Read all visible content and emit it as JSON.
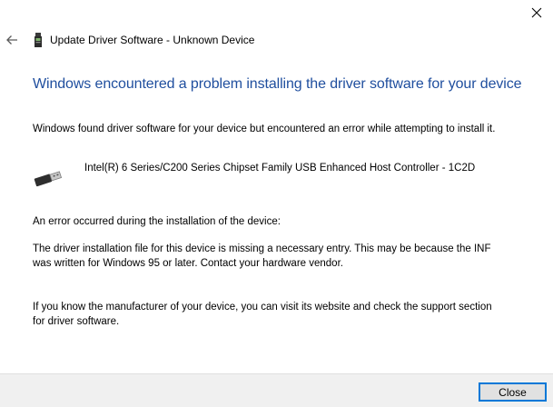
{
  "window": {
    "title": "Update Driver Software - Unknown Device",
    "close_icon": "close-icon",
    "back_icon": "back-arrow-icon",
    "title_icon": "device-icon"
  },
  "main": {
    "heading": "Windows encountered a problem installing the driver software for your device",
    "intro": "Windows found driver software for your device but encountered an error while attempting to install it.",
    "device": {
      "icon": "usb-icon",
      "name": "Intel(R) 6 Series/C200 Series Chipset Family USB Enhanced Host Controller - 1C2D"
    },
    "error_label": "An error occurred during the installation of the device:",
    "error_detail": "The driver installation file for this device is missing a necessary entry. This may be because the INF was written for Windows 95 or later. Contact your hardware vendor.",
    "support_text": "If you know the manufacturer of your device, you can visit its website and check the support section for driver software."
  },
  "footer": {
    "close_label": "Close"
  },
  "colors": {
    "heading": "#1f4e9e",
    "button_border": "#0078d7",
    "footer_bg": "#f0f0f0"
  }
}
